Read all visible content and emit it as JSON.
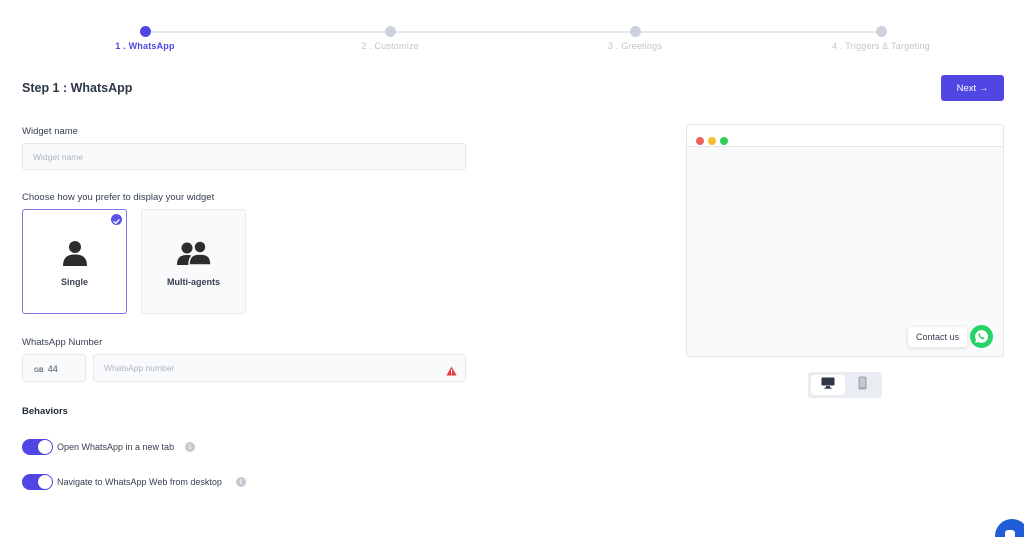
{
  "stepper": {
    "steps": [
      {
        "label": "1 . WhatsApp",
        "active": true
      },
      {
        "label": "2 . Customize",
        "active": false
      },
      {
        "label": "3 . Greetings",
        "active": false
      },
      {
        "label": "4 . Triggers & Targeting",
        "active": false
      }
    ]
  },
  "header": {
    "title": "Step 1 : WhatsApp",
    "next_label": "Next →"
  },
  "widget_name": {
    "label": "Widget name",
    "placeholder": "Widget name",
    "value": ""
  },
  "display": {
    "label": "Choose how you prefer to display your widget",
    "options": [
      {
        "label": "Single",
        "selected": true,
        "icon": "single-user-icon"
      },
      {
        "label": "Multi-agents",
        "selected": false,
        "icon": "multi-user-icon"
      }
    ]
  },
  "whatsapp_number": {
    "label": "WhatsApp Number",
    "country_code": "GB",
    "dial_code": "44",
    "placeholder": "WhatsApp number",
    "value": "",
    "warning_icon": "warning-icon"
  },
  "behaviors": {
    "title": "Behaviors",
    "items": [
      {
        "label": "Open WhatsApp in a new tab",
        "enabled": true
      },
      {
        "label": "Navigate to WhatsApp Web from desktop",
        "enabled": true
      }
    ]
  },
  "preview": {
    "contact_label": "Contact us",
    "devices": [
      {
        "name": "desktop-icon",
        "active": true
      },
      {
        "name": "mobile-icon",
        "active": false
      }
    ]
  },
  "colors": {
    "accent": "#5046e4",
    "whatsapp": "#25d366",
    "warning": "#e53e3e"
  }
}
